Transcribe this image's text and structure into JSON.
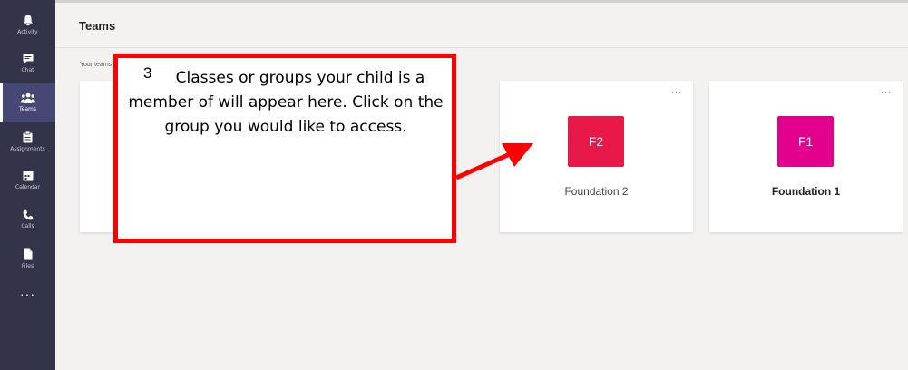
{
  "rail": {
    "items": [
      {
        "label": "Activity"
      },
      {
        "label": "Chat"
      },
      {
        "label": "Teams"
      },
      {
        "label": "Assignments"
      },
      {
        "label": "Calendar"
      },
      {
        "label": "Calls"
      },
      {
        "label": "Files"
      }
    ],
    "more": "···"
  },
  "header": {
    "title": "Teams"
  },
  "section": {
    "label": "Your teams"
  },
  "teams": [
    {
      "initials": "F2",
      "name": "Foundation 2",
      "color": "#e81849",
      "more": "···"
    },
    {
      "initials": "F1",
      "name": "Foundation 1",
      "color": "#e3008c",
      "more": "···"
    }
  ],
  "hidden_card": {
    "more": "···"
  },
  "callout": {
    "number": "3",
    "text": "Classes or groups your child is a member of will appear here. Click on the group you would like to access.",
    "border_color": "#ff0000"
  },
  "colors": {
    "rail_bg": "#33344a",
    "rail_active": "#464775",
    "canvas": "#f3f2f1",
    "arrow": "#ff0000"
  }
}
